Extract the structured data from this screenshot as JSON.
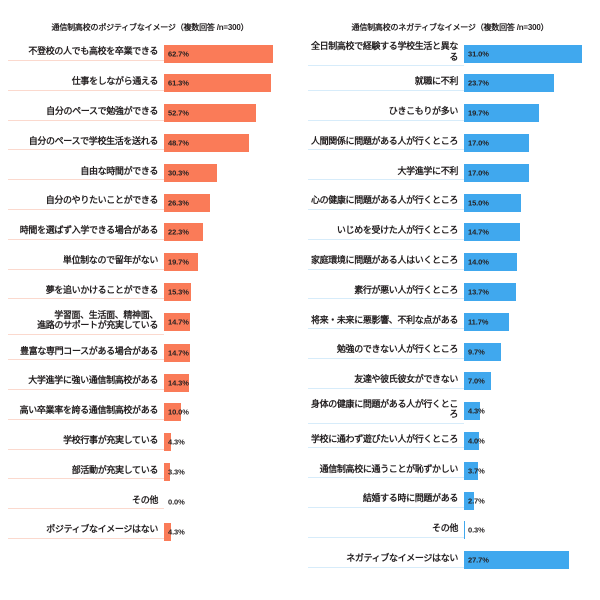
{
  "chart_data": [
    {
      "type": "bar",
      "orientation": "horizontal",
      "title": "通信制高校のポジティブなイメージ（複数回答 /n=300）",
      "xlabel": "",
      "ylabel": "",
      "unit": "%",
      "grid": false,
      "legend": "none",
      "color": "#fa7b58",
      "separator_color": "#fbd9ce",
      "xlim": [
        0,
        70
      ],
      "categories": [
        "不登校の人でも高校を卒業できる",
        "仕事をしながら通える",
        "自分のペースで勉強ができる",
        "自分のペースで学校生活を送れる",
        "自由な時間ができる",
        "自分のやりたいことができる",
        "時間を選ばず入学できる場合がある",
        "単位制なので留年がない",
        "夢を追いかけることができる",
        "学習面、生活面、精神面、\n進路のサポートが充実している",
        "豊富な専門コースがある場合がある",
        "大学進学に強い通信制高校がある",
        "高い卒業率を誇る通信制高校がある",
        "学校行事が充実している",
        "部活動が充実している",
        "その他",
        "ポジティブなイメージはない"
      ],
      "values": [
        62.7,
        61.3,
        52.7,
        48.7,
        30.3,
        26.3,
        22.3,
        19.7,
        15.3,
        14.7,
        14.7,
        14.3,
        10.0,
        4.3,
        3.3,
        0.0,
        4.3
      ],
      "value_labels": [
        "62.7%",
        "61.3%",
        "52.7%",
        "48.7%",
        "30.3%",
        "26.3%",
        "22.3%",
        "19.7%",
        "15.3%",
        "14.7%",
        "14.7%",
        "14.3%",
        "10.0%",
        "4.3%",
        "3.3%",
        "0.0%",
        "4.3%"
      ]
    },
    {
      "type": "bar",
      "orientation": "horizontal",
      "title": "通信制高校のネガティブなイメージ（複数回答 /n=300）",
      "xlabel": "",
      "ylabel": "",
      "unit": "%",
      "grid": false,
      "legend": "none",
      "color": "#40a8ee",
      "separator_color": "#d7ecfa",
      "xlim": [
        0,
        35
      ],
      "categories": [
        "全日制高校で経験する学校生活と異なる",
        "就職に不利",
        "ひきこもりが多い",
        "人間関係に問題がある人が行くところ",
        "大学進学に不利",
        "心の健康に問題がある人が行くところ",
        "いじめを受けた人が行くところ",
        "家庭環境に問題がある人はいくところ",
        "素行が悪い人が行くところ",
        "将来・未来に悪影響、不利な点がある",
        "勉強のできない人が行くところ",
        "友達や彼氏彼女ができない",
        "身体の健康に問題がある人が行くところ",
        "学校に通わず遊びたい人が行くところ",
        "通信制高校に通うことが恥ずかしい",
        "結婚する時に問題がある",
        "その他",
        "ネガティブなイメージはない"
      ],
      "values": [
        31.0,
        23.7,
        19.7,
        17.0,
        17.0,
        15.0,
        14.7,
        14.0,
        13.7,
        11.7,
        9.7,
        7.0,
        4.3,
        4.0,
        3.7,
        2.7,
        0.3,
        27.7
      ],
      "value_labels": [
        "31.0%",
        "23.7%",
        "19.7%",
        "17.0%",
        "17.0%",
        "15.0%",
        "14.7%",
        "14.0%",
        "13.7%",
        "11.7%",
        "9.7%",
        "7.0%",
        "4.3%",
        "4.0%",
        "3.7%",
        "2.7%",
        "0.3%",
        "27.7%"
      ]
    }
  ]
}
